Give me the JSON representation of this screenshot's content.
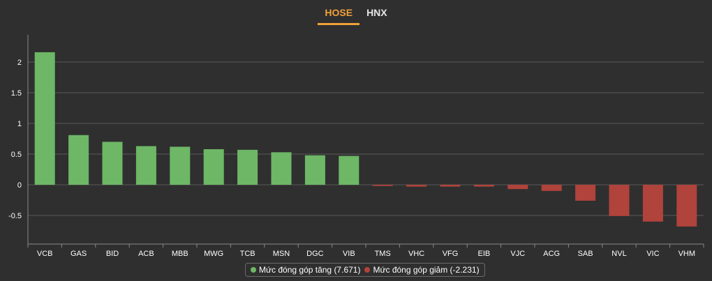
{
  "tabs": [
    {
      "label": "HOSE",
      "active": true
    },
    {
      "label": "HNX",
      "active": false
    }
  ],
  "colors": {
    "positive": "#6db766",
    "negative": "#b0433b",
    "active_tab": "#f0a13a",
    "background": "#2f2f2f"
  },
  "legend": {
    "positive_label": "Mức đóng góp tăng (7.671)",
    "negative_label": "Mức đóng góp giảm (-2.231)"
  },
  "chart_data": {
    "type": "bar",
    "categories": [
      "VCB",
      "GAS",
      "BID",
      "ACB",
      "MBB",
      "MWG",
      "TCB",
      "MSN",
      "DGC",
      "VIB",
      "TMS",
      "VHC",
      "VFG",
      "EIB",
      "VJC",
      "ACG",
      "SAB",
      "NVL",
      "VIC",
      "VHM"
    ],
    "series": [
      {
        "name": "Mức đóng góp tăng (7.671)",
        "values": [
          2.16,
          0.81,
          0.7,
          0.63,
          0.62,
          0.58,
          0.57,
          0.53,
          0.48,
          0.47,
          null,
          null,
          null,
          null,
          null,
          null,
          null,
          null,
          null,
          null
        ]
      },
      {
        "name": "Mức đóng góp giảm (-2.231)",
        "values": [
          null,
          null,
          null,
          null,
          null,
          null,
          null,
          null,
          null,
          null,
          -0.02,
          -0.03,
          -0.03,
          -0.03,
          -0.07,
          -0.1,
          -0.26,
          -0.51,
          -0.6,
          -0.68
        ]
      }
    ],
    "yticks": [
      "2",
      "1.5",
      "1",
      "0.5",
      "0",
      "-0.5"
    ],
    "ylim": [
      -0.9,
      2.45
    ],
    "grid": true,
    "legend_position": "bottom-center"
  }
}
